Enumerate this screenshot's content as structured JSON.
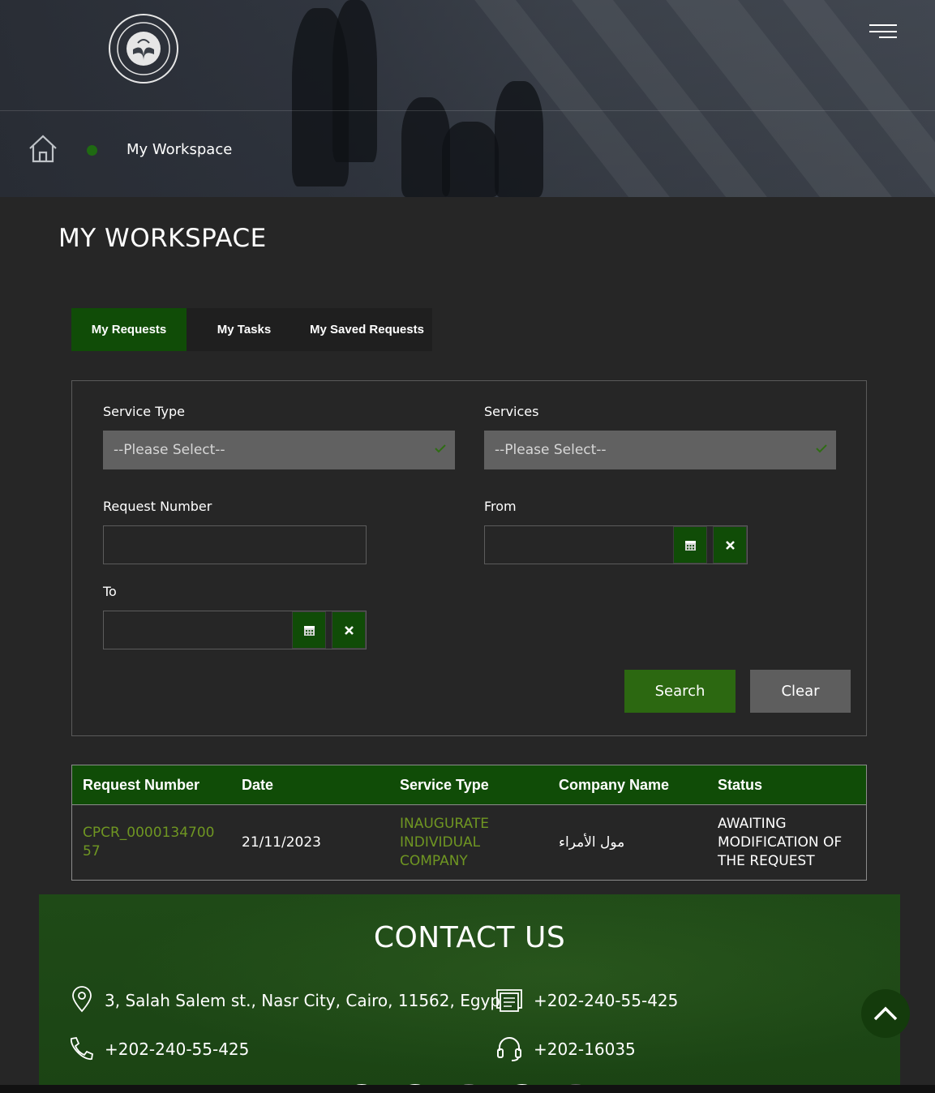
{
  "header": {
    "breadcrumb_current": "My Workspace"
  },
  "page": {
    "title": "MY WORKSPACE"
  },
  "tabs": [
    {
      "label": "My Requests",
      "active": true
    },
    {
      "label": "My Tasks",
      "active": false
    },
    {
      "label": "My Saved Requests",
      "active": false
    }
  ],
  "filters": {
    "service_type_label": "Service Type",
    "service_type_value": "--Please Select--",
    "services_label": "Services",
    "services_value": "--Please Select--",
    "request_number_label": "Request Number",
    "request_number_value": "",
    "from_label": "From",
    "from_value": "",
    "to_label": "To",
    "to_value": "",
    "search_label": "Search",
    "clear_label": "Clear"
  },
  "table": {
    "headers": [
      "Request Number",
      "Date",
      "Service Type",
      "Company Name",
      "Status"
    ],
    "rows": [
      {
        "request_number_line1": "CPCR_0000134700",
        "request_number_line2": "57",
        "date": "21/11/2023",
        "service_type_line1": "INAUGURATE",
        "service_type_line2": "INDIVIDUAL",
        "service_type_line3": "COMPANY",
        "company_name": "مول الأمراء",
        "status_line1": "AWAITING",
        "status_line2": "MODIFICATION OF",
        "status_line3": "THE REQUEST"
      }
    ]
  },
  "contact": {
    "title": "CONTACT US",
    "address": "3, Salah Salem st., Nasr City, Cairo, 11562, Egypt.",
    "fax": "+202-240-55-425",
    "phone": "+202-240-55-425",
    "hotline": "+202-16035"
  },
  "icons": {
    "logo": "authority-seal-logo",
    "menu": "hamburger-menu-icon",
    "home": "home-icon",
    "calendar": "calendar-icon",
    "clear_date": "close-icon",
    "location": "location-pin-icon",
    "fax": "fax-icon",
    "phone": "phone-icon",
    "hotline": "headset-icon",
    "scroll_top": "chevron-up-icon"
  },
  "colors": {
    "brand_green": "#104c07",
    "search_button": "#2c6811",
    "link_green": "#6f9622",
    "background": "#262626"
  }
}
